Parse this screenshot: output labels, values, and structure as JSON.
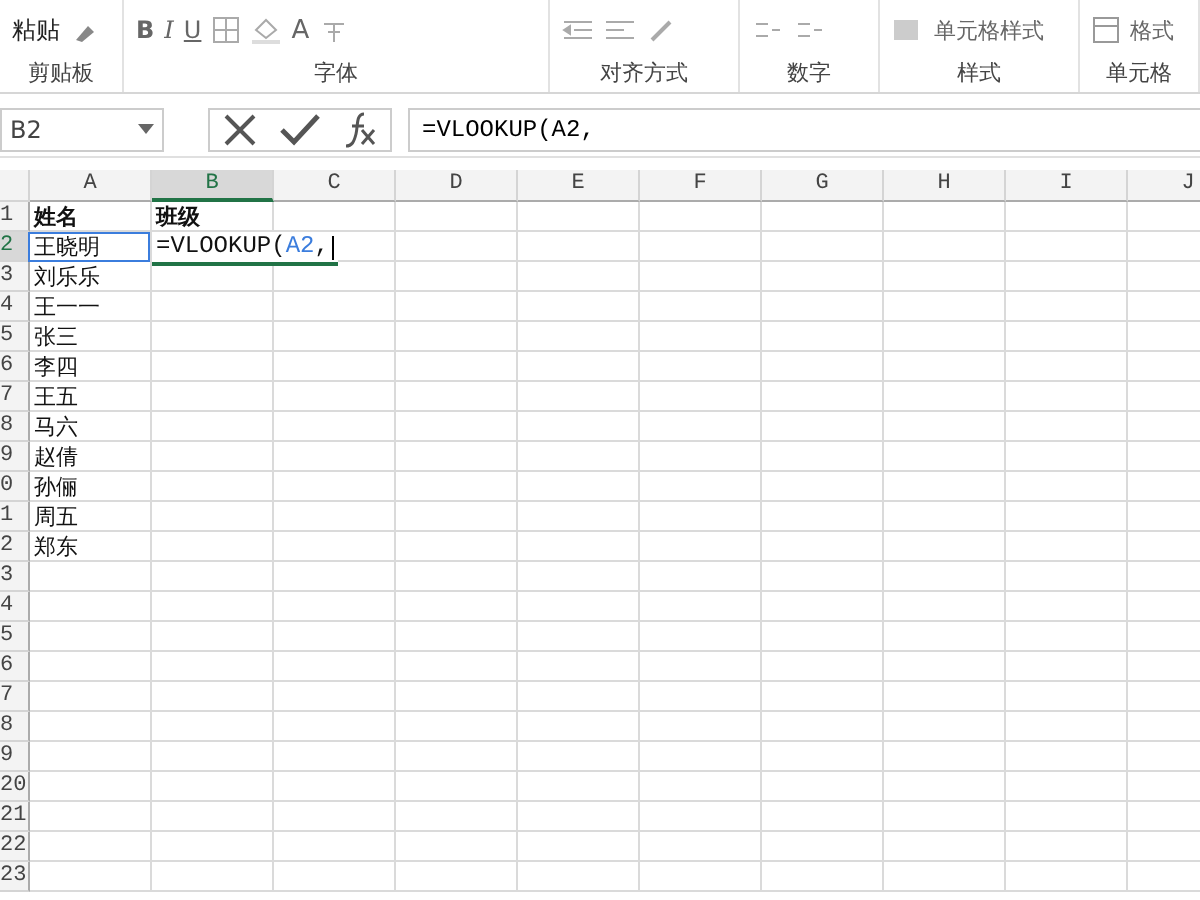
{
  "ribbon": {
    "groups": [
      {
        "label": "剪贴板",
        "buttons": [
          "粘贴"
        ]
      },
      {
        "label": "字体",
        "buttons": [
          "B",
          "I",
          "U",
          "A"
        ]
      },
      {
        "label": "对齐方式"
      },
      {
        "label": "数字"
      },
      {
        "label": "样式",
        "buttons": [
          "单元格样式"
        ]
      },
      {
        "label": "单元格",
        "buttons": [
          "格式"
        ]
      }
    ]
  },
  "formula_bar": {
    "name_box": "B2",
    "formula": "=VLOOKUP(A2,"
  },
  "columns": [
    {
      "label": "A",
      "selected": false
    },
    {
      "label": "B",
      "selected": true
    },
    {
      "label": "C",
      "selected": false
    },
    {
      "label": "D",
      "selected": false
    },
    {
      "label": "E",
      "selected": false
    },
    {
      "label": "F",
      "selected": false
    },
    {
      "label": "G",
      "selected": false
    },
    {
      "label": "H",
      "selected": false
    },
    {
      "label": "I",
      "selected": false
    },
    {
      "label": "J",
      "selected": false
    }
  ],
  "rows": [
    {
      "label": "1",
      "selected": false,
      "cells": [
        {
          "kind": "bold",
          "parts": [
            "姓名"
          ]
        },
        {
          "kind": "bold",
          "parts": [
            "班级"
          ]
        }
      ]
    },
    {
      "label": "2",
      "selected": true,
      "cells": [
        {
          "kind": "ref",
          "parts": [
            "王晓明"
          ]
        },
        {
          "kind": "edit",
          "parts": [
            "=VLOOKUP(",
            "A2",
            ","
          ]
        }
      ]
    },
    {
      "label": "3",
      "selected": false,
      "cells": [
        {
          "kind": "plain",
          "parts": [
            "刘乐乐"
          ]
        }
      ]
    },
    {
      "label": "4",
      "selected": false,
      "cells": [
        {
          "kind": "plain",
          "parts": [
            "王一一"
          ]
        }
      ]
    },
    {
      "label": "5",
      "selected": false,
      "cells": [
        {
          "kind": "plain",
          "parts": [
            "张三"
          ]
        }
      ]
    },
    {
      "label": "6",
      "selected": false,
      "cells": [
        {
          "kind": "plain",
          "parts": [
            "李四"
          ]
        }
      ]
    },
    {
      "label": "7",
      "selected": false,
      "cells": [
        {
          "kind": "plain",
          "parts": [
            "王五"
          ]
        }
      ]
    },
    {
      "label": "8",
      "selected": false,
      "cells": [
        {
          "kind": "plain",
          "parts": [
            "马六"
          ]
        }
      ]
    },
    {
      "label": "9",
      "selected": false,
      "cells": [
        {
          "kind": "plain",
          "parts": [
            "赵倩"
          ]
        }
      ]
    },
    {
      "label": "0",
      "selected": false,
      "cells": [
        {
          "kind": "plain",
          "parts": [
            "孙俪"
          ]
        }
      ]
    },
    {
      "label": "1",
      "selected": false,
      "cells": [
        {
          "kind": "plain",
          "parts": [
            "周五"
          ]
        }
      ]
    },
    {
      "label": "2",
      "selected": false,
      "cells": [
        {
          "kind": "plain",
          "parts": [
            "郑东"
          ]
        }
      ]
    },
    {
      "label": "3",
      "selected": false
    },
    {
      "label": "4",
      "selected": false
    },
    {
      "label": "5",
      "selected": false
    },
    {
      "label": "6",
      "selected": false
    },
    {
      "label": "7",
      "selected": false
    },
    {
      "label": "8",
      "selected": false
    },
    {
      "label": "9",
      "selected": false
    },
    {
      "label": "20",
      "selected": false
    },
    {
      "label": "21",
      "selected": false
    },
    {
      "label": "22",
      "selected": false
    },
    {
      "label": "23",
      "selected": false
    }
  ]
}
